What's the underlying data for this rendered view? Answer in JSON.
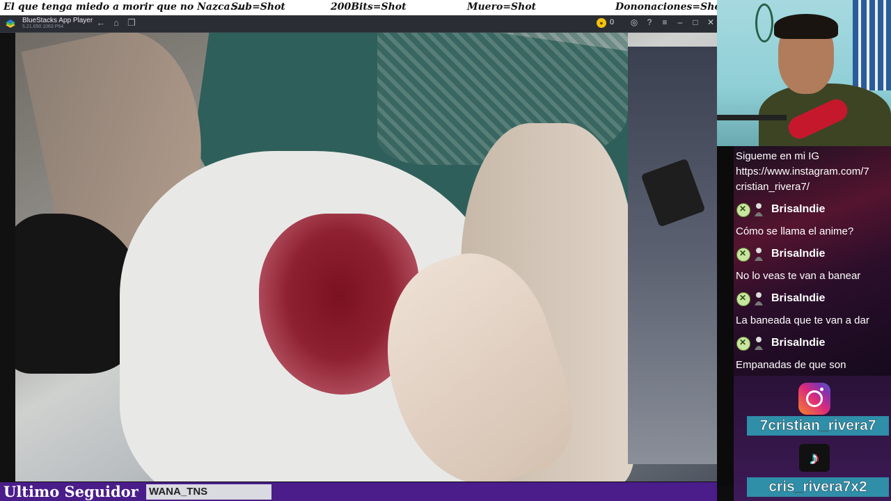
{
  "marquee": {
    "items": [
      "El que tenga miedo a morir que no Nazca....",
      "Sub=Shot",
      "200Bits=Shot",
      "Muero=Shot",
      "Dononaciones=Shot"
    ]
  },
  "bluestacks": {
    "title": "BlueStacks App Player",
    "subtitle": "5.21.650.1063 P64",
    "coin_count": "0",
    "icons": [
      "back-arrow-icon",
      "home-icon",
      "multi-window-icon",
      "coin-icon",
      "account-icon",
      "help-icon",
      "menu-icon",
      "minimize-icon",
      "maximize-icon",
      "close-icon"
    ]
  },
  "chat": {
    "intro": [
      "Sigueme en mi IG",
      "https://www.instagram.com/7",
      "cristian_rivera7/"
    ],
    "messages": [
      {
        "user": "BrisaIndie",
        "text": "Cómo se llama el anime?"
      },
      {
        "user": "BrisaIndie",
        "text": "No lo veas te van a banear"
      },
      {
        "user": "BrisaIndie",
        "text": "La baneada que te van a dar"
      },
      {
        "user": "BrisaIndie",
        "text": "Empanadas de que son"
      }
    ]
  },
  "socials": {
    "instagram_handle": "7cristian_rivera7",
    "tiktok_handle": "cris_rivera7x2",
    "tiktok_glyph": "♪"
  },
  "bottom": {
    "label": "Ultimo Seguidor",
    "name": "WANA_TNS"
  },
  "colors": {
    "banner": "#4a1d8a",
    "handle_box": "#2f8ea8",
    "chat_bg": "#54142f"
  }
}
